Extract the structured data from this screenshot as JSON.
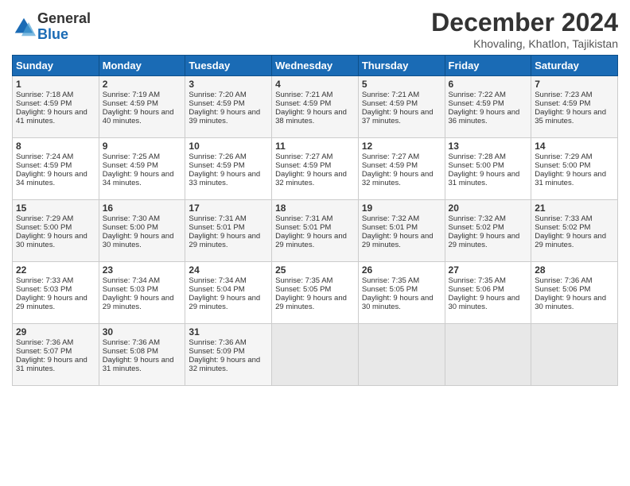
{
  "header": {
    "logo_text_general": "General",
    "logo_text_blue": "Blue",
    "title": "December 2024",
    "location": "Khovaling, Khatlon, Tajikistan"
  },
  "days_of_week": [
    "Sunday",
    "Monday",
    "Tuesday",
    "Wednesday",
    "Thursday",
    "Friday",
    "Saturday"
  ],
  "weeks": [
    [
      {
        "day": "1",
        "sunrise": "7:18 AM",
        "sunset": "4:59 PM",
        "daylight": "9 hours and 41 minutes."
      },
      {
        "day": "2",
        "sunrise": "7:19 AM",
        "sunset": "4:59 PM",
        "daylight": "9 hours and 40 minutes."
      },
      {
        "day": "3",
        "sunrise": "7:20 AM",
        "sunset": "4:59 PM",
        "daylight": "9 hours and 39 minutes."
      },
      {
        "day": "4",
        "sunrise": "7:21 AM",
        "sunset": "4:59 PM",
        "daylight": "9 hours and 38 minutes."
      },
      {
        "day": "5",
        "sunrise": "7:21 AM",
        "sunset": "4:59 PM",
        "daylight": "9 hours and 37 minutes."
      },
      {
        "day": "6",
        "sunrise": "7:22 AM",
        "sunset": "4:59 PM",
        "daylight": "9 hours and 36 minutes."
      },
      {
        "day": "7",
        "sunrise": "7:23 AM",
        "sunset": "4:59 PM",
        "daylight": "9 hours and 35 minutes."
      }
    ],
    [
      {
        "day": "8",
        "sunrise": "7:24 AM",
        "sunset": "4:59 PM",
        "daylight": "9 hours and 34 minutes."
      },
      {
        "day": "9",
        "sunrise": "7:25 AM",
        "sunset": "4:59 PM",
        "daylight": "9 hours and 34 minutes."
      },
      {
        "day": "10",
        "sunrise": "7:26 AM",
        "sunset": "4:59 PM",
        "daylight": "9 hours and 33 minutes."
      },
      {
        "day": "11",
        "sunrise": "7:27 AM",
        "sunset": "4:59 PM",
        "daylight": "9 hours and 32 minutes."
      },
      {
        "day": "12",
        "sunrise": "7:27 AM",
        "sunset": "4:59 PM",
        "daylight": "9 hours and 32 minutes."
      },
      {
        "day": "13",
        "sunrise": "7:28 AM",
        "sunset": "5:00 PM",
        "daylight": "9 hours and 31 minutes."
      },
      {
        "day": "14",
        "sunrise": "7:29 AM",
        "sunset": "5:00 PM",
        "daylight": "9 hours and 31 minutes."
      }
    ],
    [
      {
        "day": "15",
        "sunrise": "7:29 AM",
        "sunset": "5:00 PM",
        "daylight": "9 hours and 30 minutes."
      },
      {
        "day": "16",
        "sunrise": "7:30 AM",
        "sunset": "5:00 PM",
        "daylight": "9 hours and 30 minutes."
      },
      {
        "day": "17",
        "sunrise": "7:31 AM",
        "sunset": "5:01 PM",
        "daylight": "9 hours and 29 minutes."
      },
      {
        "day": "18",
        "sunrise": "7:31 AM",
        "sunset": "5:01 PM",
        "daylight": "9 hours and 29 minutes."
      },
      {
        "day": "19",
        "sunrise": "7:32 AM",
        "sunset": "5:01 PM",
        "daylight": "9 hours and 29 minutes."
      },
      {
        "day": "20",
        "sunrise": "7:32 AM",
        "sunset": "5:02 PM",
        "daylight": "9 hours and 29 minutes."
      },
      {
        "day": "21",
        "sunrise": "7:33 AM",
        "sunset": "5:02 PM",
        "daylight": "9 hours and 29 minutes."
      }
    ],
    [
      {
        "day": "22",
        "sunrise": "7:33 AM",
        "sunset": "5:03 PM",
        "daylight": "9 hours and 29 minutes."
      },
      {
        "day": "23",
        "sunrise": "7:34 AM",
        "sunset": "5:03 PM",
        "daylight": "9 hours and 29 minutes."
      },
      {
        "day": "24",
        "sunrise": "7:34 AM",
        "sunset": "5:04 PM",
        "daylight": "9 hours and 29 minutes."
      },
      {
        "day": "25",
        "sunrise": "7:35 AM",
        "sunset": "5:05 PM",
        "daylight": "9 hours and 29 minutes."
      },
      {
        "day": "26",
        "sunrise": "7:35 AM",
        "sunset": "5:05 PM",
        "daylight": "9 hours and 30 minutes."
      },
      {
        "day": "27",
        "sunrise": "7:35 AM",
        "sunset": "5:06 PM",
        "daylight": "9 hours and 30 minutes."
      },
      {
        "day": "28",
        "sunrise": "7:36 AM",
        "sunset": "5:06 PM",
        "daylight": "9 hours and 30 minutes."
      }
    ],
    [
      {
        "day": "29",
        "sunrise": "7:36 AM",
        "sunset": "5:07 PM",
        "daylight": "9 hours and 31 minutes."
      },
      {
        "day": "30",
        "sunrise": "7:36 AM",
        "sunset": "5:08 PM",
        "daylight": "9 hours and 31 minutes."
      },
      {
        "day": "31",
        "sunrise": "7:36 AM",
        "sunset": "5:09 PM",
        "daylight": "9 hours and 32 minutes."
      },
      null,
      null,
      null,
      null
    ]
  ]
}
